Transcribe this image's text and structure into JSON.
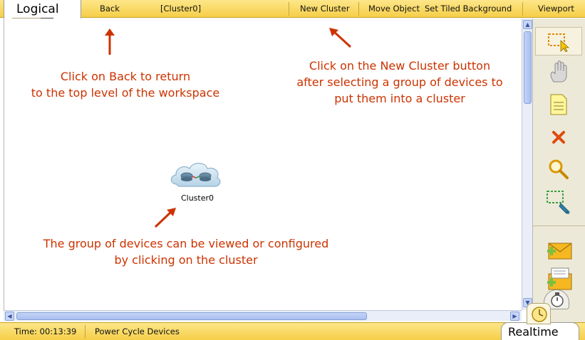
{
  "header": {
    "logical_tab": "Logical",
    "back_label": "Back",
    "path_label": "[Cluster0]",
    "new_cluster_label": "New Cluster",
    "move_object_label": "Move Object",
    "set_tiled_background_label": "Set Tiled Background",
    "viewport_label": "Viewport"
  },
  "workspace": {
    "cluster_label": "Cluster0",
    "notes": {
      "back_line1": "Click on Back to return",
      "back_line2": "to the top level of the workspace",
      "new_cluster_line1": "Click on the New Cluster button",
      "new_cluster_line2": "after selecting a group of devices to",
      "new_cluster_line3": "put them into a cluster",
      "cluster_line1": "The group of devices can be viewed or configured",
      "cluster_line2": "by clicking on the cluster"
    }
  },
  "palette": {
    "tools": [
      "select-icon",
      "hand-icon",
      "note-icon",
      "delete-icon",
      "inspect-icon",
      "resize-icon",
      "add-simple-pdu-icon",
      "add-complex-pdu-icon"
    ]
  },
  "status": {
    "time": "Time: 00:13:39",
    "power_cycle_label": "Power Cycle Devices",
    "realtime_tab": "Realtime"
  },
  "colors": {
    "toolbar": "#f6cf48",
    "annotation": "#cc3300",
    "palette": "#ece9d8"
  }
}
